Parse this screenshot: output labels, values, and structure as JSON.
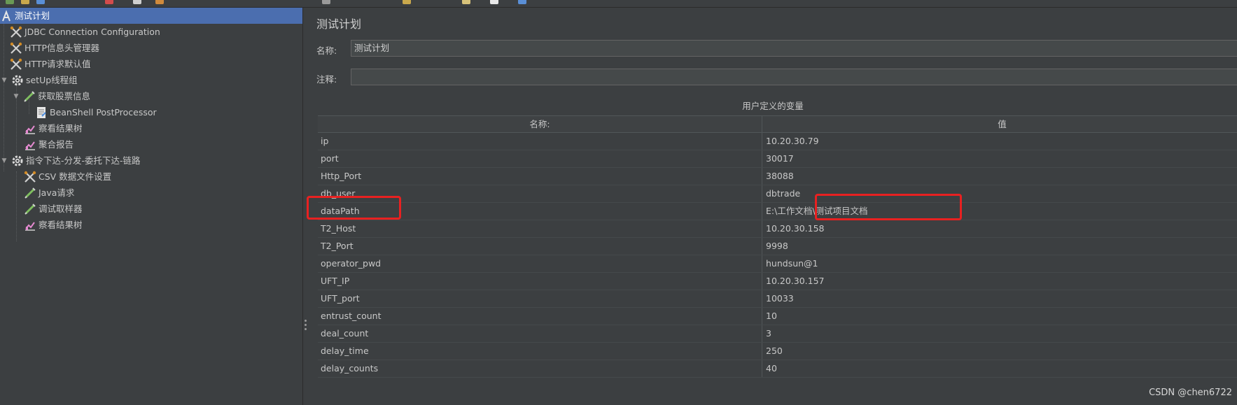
{
  "toolbar": {
    "icons": [
      "new-icon",
      "open-icon",
      "save-icon",
      "cut-icon",
      "copy-icon",
      "paste-icon",
      "run-icon",
      "stop-icon",
      "clear-icon",
      "search-icon",
      "help-icon"
    ]
  },
  "tree": {
    "items": [
      {
        "label": "测试计划",
        "icon": "test-plan-icon",
        "selected": true
      },
      {
        "label": "JDBC Connection Configuration",
        "icon": "config-icon"
      },
      {
        "label": "HTTP信息头管理器",
        "icon": "config-icon"
      },
      {
        "label": "HTTP请求默认值",
        "icon": "config-icon"
      },
      {
        "label": "setUp线程组",
        "icon": "gear-icon",
        "toggle": "▼"
      },
      {
        "label": "获取股票信息",
        "icon": "sampler-icon",
        "toggle": "▼"
      },
      {
        "label": "BeanShell PostProcessor",
        "icon": "script-icon"
      },
      {
        "label": "察看结果树",
        "icon": "listener-icon"
      },
      {
        "label": "聚合报告",
        "icon": "listener-icon"
      },
      {
        "label": "指令下达-分发-委托下达-链路",
        "icon": "gear-icon",
        "toggle": "▼"
      },
      {
        "label": "CSV 数据文件设置",
        "icon": "config-icon"
      },
      {
        "label": "Java请求",
        "icon": "sampler-icon"
      },
      {
        "label": "调试取样器",
        "icon": "sampler-icon"
      },
      {
        "label": "察看结果树",
        "icon": "listener-icon"
      }
    ]
  },
  "main": {
    "title": "测试计划",
    "name_label": "名称:",
    "name_value": "测试计划",
    "comment_label": "注释:",
    "comment_value": "",
    "section_title": "用户定义的变量",
    "table": {
      "headers": [
        "名称:",
        "值"
      ],
      "rows": [
        [
          "ip",
          "10.20.30.79"
        ],
        [
          "port",
          "30017"
        ],
        [
          "Http_Port",
          "38088"
        ],
        [
          "db_user",
          "dbtrade"
        ],
        [
          "dataPath",
          "E:\\工作文档\\测试项目文档"
        ],
        [
          "T2_Host",
          "10.20.30.158"
        ],
        [
          "T2_Port",
          "9998"
        ],
        [
          "operator_pwd",
          "hundsun@1"
        ],
        [
          "UFT_IP",
          "10.20.30.157"
        ],
        [
          "UFT_port",
          "10033"
        ],
        [
          "entrust_count",
          "10"
        ],
        [
          "deal_count",
          "3"
        ],
        [
          "delay_time",
          "250"
        ],
        [
          "delay_counts",
          "40"
        ]
      ]
    }
  },
  "watermark": "CSDN @chen6722",
  "colors": {
    "background": "#3c3f41",
    "selection": "#4b6eaf",
    "highlight": "#e82121"
  }
}
